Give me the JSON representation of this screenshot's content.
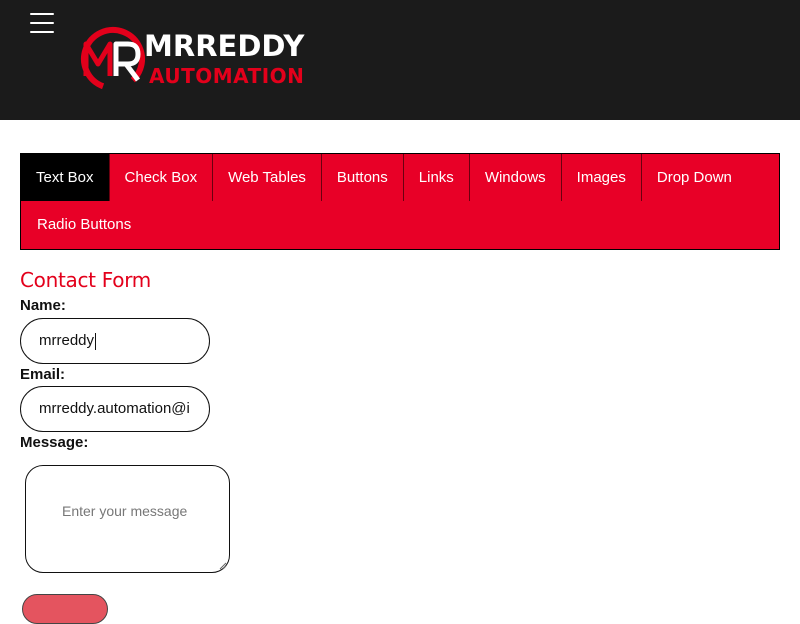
{
  "header": {
    "brand_line_1": "MRREDDY",
    "brand_line_2": "AUTOMATION",
    "logo_initials": "MR"
  },
  "icons": {
    "menu": "hamburger-menu-icon"
  },
  "colors": {
    "header_bg": "#1b1b1b",
    "accent_red": "#e80027",
    "active_tab_bg": "#000000",
    "title_red": "#e3001b"
  },
  "nav": {
    "items": [
      {
        "label": "Text Box",
        "active": true
      },
      {
        "label": "Check Box",
        "active": false
      },
      {
        "label": "Web Tables",
        "active": false
      },
      {
        "label": "Buttons",
        "active": false
      },
      {
        "label": "Links",
        "active": false
      },
      {
        "label": "Windows",
        "active": false
      },
      {
        "label": "Images",
        "active": false
      },
      {
        "label": "Drop Down",
        "active": false
      },
      {
        "label": "Radio Buttons",
        "active": false
      }
    ]
  },
  "form": {
    "title": "Contact Form",
    "name_label": "Name:",
    "name_value": "mrreddy",
    "email_label": "Email:",
    "email_value": "mrreddy.automation@i",
    "message_label": "Message:",
    "message_placeholder": "Enter your message"
  }
}
